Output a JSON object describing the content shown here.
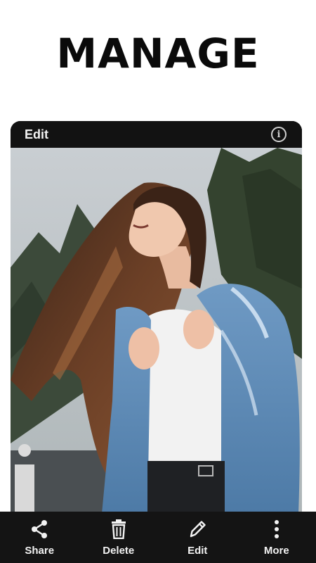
{
  "headline": "MANAGE",
  "editor": {
    "title": "Edit",
    "info_icon": "info-icon",
    "info_glyph": "i",
    "photo": "photo-woman-denim-jacket"
  },
  "bottom_bar": {
    "share": {
      "label": "Share",
      "icon": "share-icon"
    },
    "delete": {
      "label": "Delete",
      "icon": "trash-icon"
    },
    "edit": {
      "label": "Edit",
      "icon": "pencil-icon"
    },
    "more": {
      "label": "More",
      "icon": "more-vertical-icon"
    }
  },
  "colors": {
    "bar_background": "#141414",
    "text_light": "#f2f2f2",
    "headline": "#0a0a0a"
  }
}
